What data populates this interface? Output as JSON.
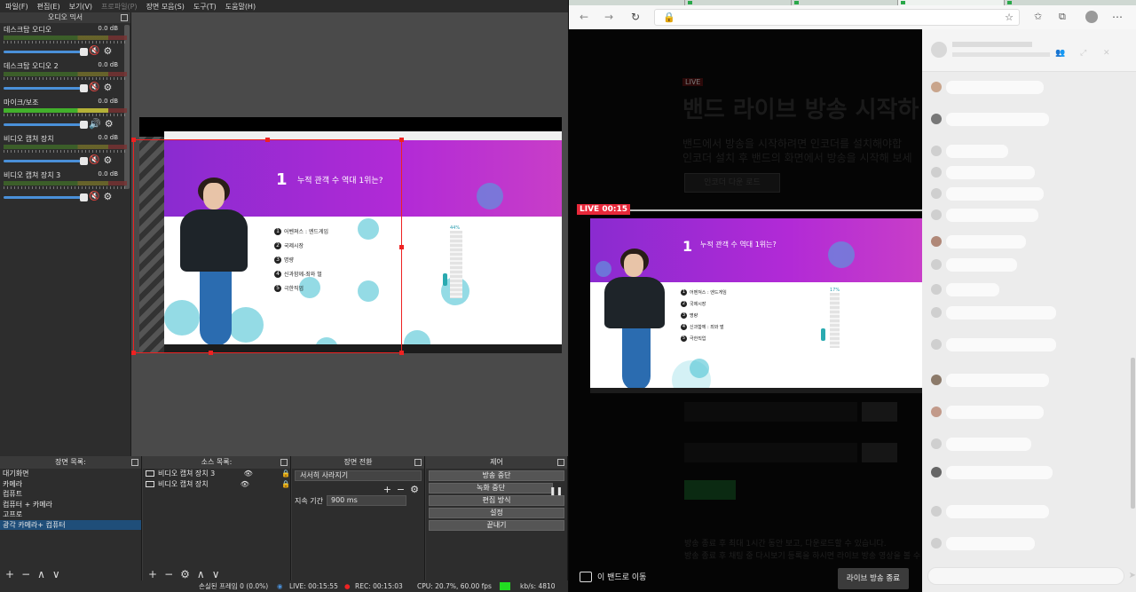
{
  "obs": {
    "menu": [
      {
        "label": "파일(F)",
        "enabled": true
      },
      {
        "label": "편집(E)",
        "enabled": true
      },
      {
        "label": "보기(V)",
        "enabled": true
      },
      {
        "label": "프로파일(P)",
        "enabled": false
      },
      {
        "label": "장면 모음(S)",
        "enabled": true
      },
      {
        "label": "도구(T)",
        "enabled": true
      },
      {
        "label": "도움말(H)",
        "enabled": true
      }
    ],
    "mixer": {
      "title": "오디오 믹서",
      "channels": [
        {
          "name": "데스크탑 오디오",
          "db": "0.0 dB"
        },
        {
          "name": "데스크탑 오디오 2",
          "db": "0.0 dB"
        },
        {
          "name": "마이크/보조",
          "db": "0.0 dB"
        },
        {
          "name": "비디오 캡쳐 장치",
          "db": "0.0 dB"
        },
        {
          "name": "비디오 캡쳐 장치 3",
          "db": "0.0 dB"
        }
      ]
    },
    "scenes": {
      "title": "장면 목록:",
      "items": [
        "대기화면",
        "카메라",
        "컴퓨트",
        "컴퓨터 + 카메라",
        "고프로",
        "광각 카메라+ 컴퓨터"
      ],
      "active_index": 5
    },
    "sources": {
      "title": "소스 목록:",
      "items": [
        "비디오 캡쳐 장치 3",
        "비디오 캡쳐 장치"
      ]
    },
    "transitions": {
      "title": "장면 전환",
      "type": "서서히 사라지기",
      "duration_label": "지속 기간",
      "duration_value": "900 ms"
    },
    "controls": {
      "title": "제어",
      "stop_stream": "방송 중단",
      "stop_record": "녹화 중단",
      "studio_mode": "편집 방식",
      "settings": "설정",
      "exit": "끝내기"
    },
    "status": {
      "dropped": "손실된 프레임 0 (0.0%)",
      "live": "LIVE: 00:15:55",
      "rec": "REC: 00:15:03",
      "cpu": "CPU: 20.7%, 60.00 fps",
      "kbps": "kb/s: 4810"
    },
    "slide": {
      "number": "1",
      "question": "누적 관객 수 역대 1위는?",
      "options": [
        "어벤져스 : 엔드게임",
        "국제시장",
        "명량",
        "신과함께-죄와 벌",
        "극한직업"
      ],
      "bar_label": "44%"
    }
  },
  "browser": {
    "live_small": "LIVE",
    "live_title": "밴드 라이브 방송 시작하",
    "desc1": "밴드에서 방송을 시작하려면 인코더를 설치해야합",
    "desc2": "인코더 설치 후 밴드의 화면에서 방송을 시작해 보세",
    "dim_button": "인코더 다운 로드",
    "live_badge": "LIVE 00:15",
    "stream_slide": {
      "number": "1",
      "question": "누적 관객 수 역대 1위는?",
      "options": [
        "어벤져스 : 엔드게임",
        "국제시장",
        "명량",
        "신과함께 : 죄와 벌",
        "극한직업"
      ],
      "bar_label": "17%"
    },
    "note1": "방송 종료 후 최대 1시간 동안 보고, 다운로드할 수 있습니다.",
    "note2": "방송 종료 후 채팅 중 다시보기 등록을 하시면 라이브 방송 영상을 볼 수 있습니다.",
    "go_band": "이 밴드로 이동",
    "end_live": "라이브 방송 종료"
  },
  "colors": {
    "accent_blue": "#4a90d9",
    "live_red": "#e8283a",
    "selection_red": "#e22222",
    "slide_purple": "#9a2bd4"
  }
}
